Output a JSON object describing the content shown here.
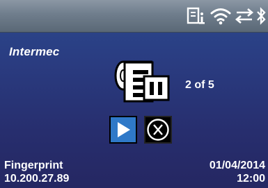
{
  "status_bar": {
    "icons": [
      "sim-card-icon",
      "wifi-icon",
      "network-transfer-icon",
      "bluetooth-icon"
    ]
  },
  "brand": {
    "logo_text": "Intermec"
  },
  "print_job": {
    "icon": "printer-paused-icon",
    "count_text": "2 of 5"
  },
  "actions": {
    "resume_icon": "play-icon",
    "cancel_icon": "cancel-x-icon"
  },
  "footer": {
    "app_name": "Fingerprint",
    "ip_address": "10.200.27.89",
    "date": "01/04/2014",
    "time": "12:00"
  },
  "colors": {
    "background": "#283778",
    "status_bar": "#6f7d8c",
    "play_button": "#2f79c8",
    "text": "#ffffff"
  }
}
